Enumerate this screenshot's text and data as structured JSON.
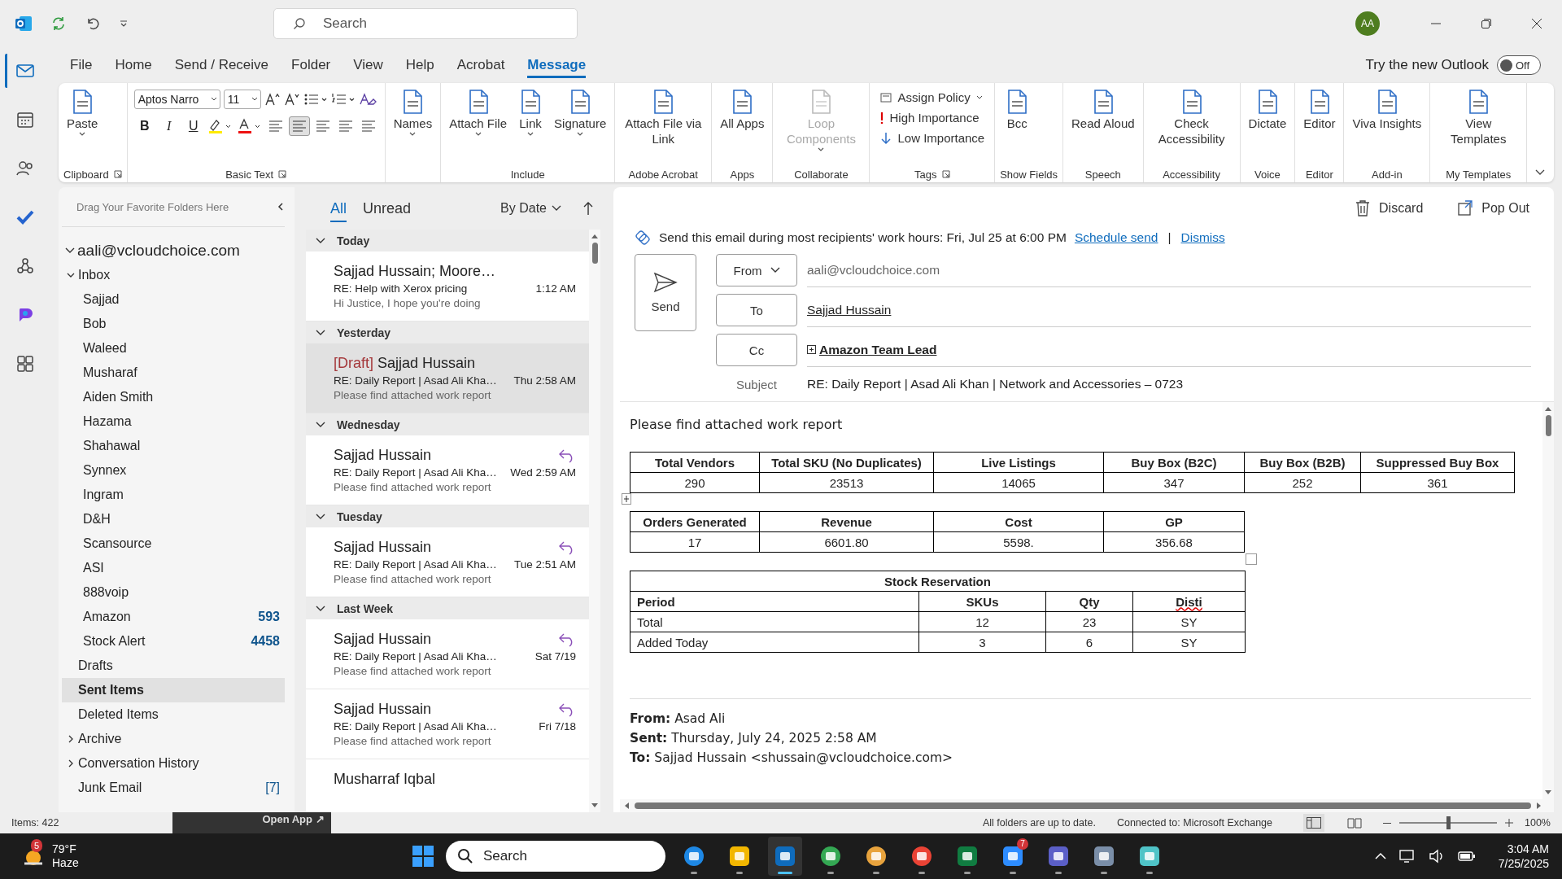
{
  "title_bar": {
    "search_placeholder": "Search",
    "avatar": "AA"
  },
  "rail": [
    {
      "selected": true
    },
    {
      "selected": false
    },
    {
      "selected": false
    },
    {
      "selected": false
    },
    {
      "selected": false
    },
    {
      "selected": false
    },
    {
      "selected": false
    }
  ],
  "menu_tabs": [
    {
      "label": "File",
      "selected": false
    },
    {
      "label": "Home",
      "selected": false
    },
    {
      "label": "Send / Receive",
      "selected": false
    },
    {
      "label": "Folder",
      "selected": false
    },
    {
      "label": "View",
      "selected": false
    },
    {
      "label": "Help",
      "selected": false
    },
    {
      "label": "Acrobat",
      "selected": false
    },
    {
      "label": "Message",
      "selected": true
    }
  ],
  "new_outlook": {
    "label": "Try the new Outlook",
    "toggle": "Off",
    "on": false
  },
  "ribbon": [
    {
      "kind": "large",
      "label": "Clipboard",
      "launcher": true,
      "buttons": [
        {
          "label": "Paste",
          "dropdown": true,
          "disabled": false
        }
      ]
    },
    {
      "kind": "basic",
      "label": "Basic Text",
      "launcher": true,
      "font": "Aptos Narro",
      "size": "11",
      "format_buttons": [
        "B",
        "I",
        "U"
      ]
    },
    {
      "kind": "large",
      "buttons": [
        {
          "label": "Names",
          "dropdown": true,
          "disabled": false
        }
      ]
    },
    {
      "kind": "large",
      "label": "Include",
      "buttons": [
        {
          "label": "Attach File",
          "dropdown": true,
          "disabled": false
        },
        {
          "label": "Link",
          "dropdown": true,
          "disabled": false
        },
        {
          "label": "Signature",
          "dropdown": true,
          "disabled": false
        }
      ]
    },
    {
      "kind": "large",
      "label": "Adobe Acrobat",
      "buttons": [
        {
          "label": "Attach File via Link",
          "dropdown": false,
          "disabled": false
        }
      ]
    },
    {
      "kind": "large",
      "label": "Apps",
      "buttons": [
        {
          "label": "All Apps",
          "dropdown": false,
          "disabled": false
        }
      ]
    },
    {
      "kind": "large",
      "label": "Collaborate",
      "buttons": [
        {
          "label": "Loop Components",
          "dropdown": true,
          "disabled": true
        }
      ]
    },
    {
      "kind": "small",
      "label": "Tags",
      "launcher": true,
      "buttons": [
        {
          "label": "Assign Policy",
          "dropdown": true
        },
        {
          "label": "High Importance",
          "dropdown": false
        },
        {
          "label": "Low Importance",
          "dropdown": false
        }
      ]
    },
    {
      "kind": "large",
      "label": "Show Fields",
      "buttons": [
        {
          "label": "Bcc",
          "dropdown": false,
          "disabled": false
        }
      ]
    },
    {
      "kind": "large",
      "label": "Speech",
      "buttons": [
        {
          "label": "Read Aloud",
          "dropdown": false,
          "disabled": false
        }
      ]
    },
    {
      "kind": "large",
      "label": "Accessibility",
      "buttons": [
        {
          "label": "Check Accessibility",
          "dropdown": false,
          "disabled": false
        }
      ]
    },
    {
      "kind": "large",
      "label": "Voice",
      "buttons": [
        {
          "label": "Dictate",
          "dropdown": false,
          "disabled": false
        }
      ]
    },
    {
      "kind": "large",
      "label": "Editor",
      "buttons": [
        {
          "label": "Editor",
          "dropdown": false,
          "disabled": false
        }
      ]
    },
    {
      "kind": "large",
      "label": "Add-in",
      "buttons": [
        {
          "label": "Viva Insights",
          "dropdown": false,
          "disabled": false
        }
      ]
    },
    {
      "kind": "large",
      "label": "My Templates",
      "buttons": [
        {
          "label": "View Templates",
          "dropdown": false,
          "disabled": false
        }
      ]
    }
  ],
  "folder_pane": {
    "favorites_hint": "Drag Your Favorite Folders Here",
    "account": "aali@vcloudchoice.com",
    "folders": [
      {
        "label": "Inbox",
        "expanded": true,
        "selected": false,
        "children": [
          {
            "label": "Sajjad",
            "selected": false
          },
          {
            "label": "Bob",
            "selected": false
          },
          {
            "label": "Waleed",
            "selected": false
          },
          {
            "label": "Musharaf",
            "selected": false
          },
          {
            "label": "Aiden Smith",
            "selected": false
          },
          {
            "label": "Hazama",
            "selected": false
          },
          {
            "label": "Shahawal",
            "selected": false
          },
          {
            "label": "Synnex",
            "selected": false
          },
          {
            "label": "Ingram",
            "selected": false
          },
          {
            "label": "D&H",
            "selected": false
          },
          {
            "label": "Scansource",
            "selected": false
          },
          {
            "label": "ASI",
            "selected": false
          },
          {
            "label": "888voip",
            "selected": false
          },
          {
            "label": "Amazon",
            "selected": false,
            "count": "593"
          },
          {
            "label": "Stock Alert",
            "selected": false,
            "count": "4458"
          }
        ]
      },
      {
        "label": "Drafts",
        "selected": false
      },
      {
        "label": "Sent Items",
        "selected": true
      },
      {
        "label": "Deleted Items",
        "selected": false
      },
      {
        "label": "Archive",
        "expanded": false,
        "selected": false
      },
      {
        "label": "Conversation History",
        "expanded": false,
        "selected": false
      },
      {
        "label": "Junk Email",
        "selected": false,
        "note": "[7]"
      }
    ]
  },
  "message_list": {
    "filters": [
      {
        "label": "All",
        "selected": true
      },
      {
        "label": "Unread",
        "selected": false
      }
    ],
    "sort": "By Date",
    "groups": [
      {
        "label": "Today",
        "messages": [
          {
            "sender": "Sajjad Hussain; Moore…",
            "subject": "RE: Help with Xerox pricing",
            "time": "1:12 AM",
            "preview": "Hi Justice,  I hope you're doing",
            "replied": false,
            "selected": false
          }
        ]
      },
      {
        "label": "Yesterday",
        "messages": [
          {
            "draft": "[Draft]",
            "sender": "Sajjad Hussain",
            "subject": "RE: Daily Report | Asad Ali Kha…",
            "time": "Thu 2:58 AM",
            "preview": "Please find attached work report",
            "replied": false,
            "selected": true
          }
        ]
      },
      {
        "label": "Wednesday",
        "messages": [
          {
            "sender": "Sajjad Hussain",
            "subject": "RE: Daily Report | Asad Ali Kha…",
            "time": "Wed 2:59 AM",
            "preview": "Please find attached work report",
            "replied": true,
            "selected": false
          }
        ]
      },
      {
        "label": "Tuesday",
        "messages": [
          {
            "sender": "Sajjad Hussain",
            "subject": "RE: Daily Report | Asad Ali Kha…",
            "time": "Tue 2:51 AM",
            "preview": "Please find attached work report",
            "replied": true,
            "selected": false
          }
        ]
      },
      {
        "label": "Last Week",
        "messages": [
          {
            "sender": "Sajjad Hussain",
            "subject": "RE: Daily Report | Asad Ali Kha…",
            "time": "Sat 7/19",
            "preview": "Please find attached work report",
            "replied": true,
            "selected": false
          },
          {
            "sender": "Sajjad Hussain",
            "subject": "RE: Daily Report | Asad Ali Kha…",
            "time": "Fri 7/18",
            "preview": "Please find attached work report",
            "replied": true,
            "selected": false
          },
          {
            "sender": "Musharraf Iqbal",
            "replied": false,
            "selected": false
          }
        ]
      }
    ]
  },
  "compose": {
    "actions": [
      "Discard",
      "Pop Out"
    ],
    "hint": "Send this email during most recipients' work hours: Fri, Jul 25 at 6:00 PM",
    "hint_links": [
      "Schedule send",
      "Dismiss"
    ],
    "hint_separator": "|",
    "send": "Send",
    "fields": [
      {
        "kind": "from",
        "button": "From",
        "value": "aali@vcloudchoice.com"
      },
      {
        "kind": "to",
        "button": "To",
        "value": "Sajjad Hussain"
      },
      {
        "kind": "group",
        "button": "Cc",
        "value": "Amazon Team Lead"
      },
      {
        "kind": "subject",
        "button": "Subject",
        "value": "RE: Daily Report | Asad Ali Khan | Network and Accessories – 0723"
      }
    ],
    "body": {
      "intro": "Please find attached work report",
      "tables": [
        {
          "columns": [
            "Total Vendors",
            "Total SKU (No Duplicates)",
            "Live Listings",
            "Buy Box (B2C)",
            "Buy Box (B2B)",
            "Suppressed Buy Box"
          ],
          "rows": [
            [
              "290",
              "23513",
              "14065",
              "347",
              "252",
              "361"
            ]
          ]
        },
        {
          "columns": [
            "Orders Generated",
            "Revenue",
            "Cost",
            "GP"
          ],
          "rows": [
            [
              "17",
              "6601.80",
              "5598.",
              "356.68"
            ]
          ]
        },
        {
          "title": "Stock Reservation",
          "columns": [
            "Period",
            "SKUs",
            "Qty",
            "Disti"
          ],
          "rows": [
            [
              "Total",
              "12",
              "23",
              "SY"
            ],
            [
              "Added Today",
              "3",
              "6",
              "SY"
            ]
          ]
        }
      ],
      "quoted_header": [
        "**From:** Asad Ali",
        "**Sent:** Thursday, July 24, 2025 2:58 AM",
        "**To:** Sajjad Hussain <shussain@vcloudchoice.com>"
      ]
    }
  },
  "status_bar": {
    "items": "Items: 422",
    "popup": "Open App ↗",
    "sync": "All folders are up to date.",
    "connection": "Connected to: Microsoft Exchange",
    "zoom": "100%",
    "level": 0.5
  },
  "taskbar": {
    "weather_badge": "5",
    "temperature": "79°F",
    "weather": "Haze",
    "search_placeholder": "Search",
    "apps": [
      {
        "active": false
      },
      {
        "active": false
      },
      {
        "active": true
      },
      {
        "active": false
      },
      {
        "active": false
      },
      {
        "active": false
      },
      {
        "active": false
      },
      {
        "active": false,
        "badge": "7"
      },
      {
        "active": false
      },
      {
        "active": false
      },
      {
        "active": false
      }
    ],
    "time": "3:04 AM",
    "date": "7/25/2025"
  }
}
